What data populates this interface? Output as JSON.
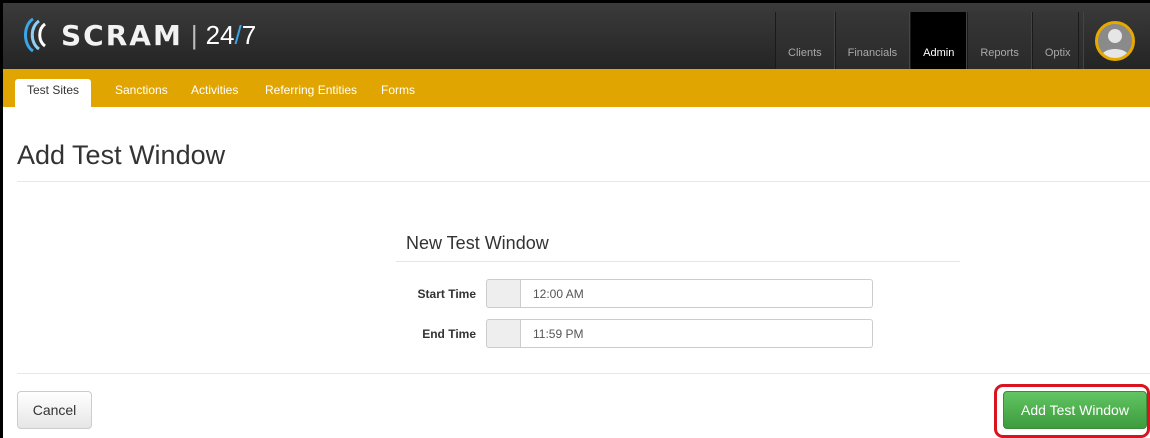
{
  "brand": {
    "name": "SCRAM",
    "separator": "|",
    "suffix_a": "24",
    "suffix_slash": "/",
    "suffix_b": "7"
  },
  "nav": [
    {
      "label": "Clients"
    },
    {
      "label": "Financials"
    },
    {
      "label": "Admin"
    },
    {
      "label": "Reports"
    },
    {
      "label": "Optix"
    }
  ],
  "subnav": [
    {
      "label": "Test Sites"
    },
    {
      "label": "Sanctions"
    },
    {
      "label": "Activities"
    },
    {
      "label": "Referring Entities"
    },
    {
      "label": "Forms"
    }
  ],
  "page": {
    "title": "Add Test Window"
  },
  "form": {
    "title": "New Test Window",
    "start_label": "Start Time",
    "start_value": "12:00 AM",
    "end_label": "End Time",
    "end_value": "11:59 PM"
  },
  "actions": {
    "cancel_label": "Cancel",
    "submit_label": "Add Test Window"
  },
  "colors": {
    "accent_yellow": "#e0a500",
    "success_green": "#4cae4c",
    "highlight_red": "#d9141e",
    "header_dark": "#2b2b2b"
  }
}
